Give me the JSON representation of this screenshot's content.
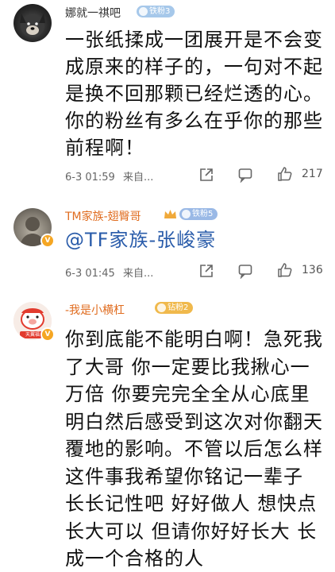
{
  "comments": [
    {
      "username": "娜就一祺吧",
      "fan_badge": "铁粉3",
      "text": "一张纸揉成一团展开是不会变成原来的样子的，一句对不起是换不回那颗已经烂透的心。你的粉丝有多么在乎你的那些前程啊！",
      "time": "6-3 01:59",
      "source": "来自...",
      "like_count": "217"
    },
    {
      "username": "TM家族-翅臀哥",
      "fan_badge": "铁粉5",
      "verified_badge": "V",
      "text": "@TF家族-张峻豪",
      "time": "6-3 01:45",
      "source": "来自...",
      "like_count": "136"
    },
    {
      "username": "-我是小横杠",
      "fan_badge": "钻粉2",
      "verified_badge": "V",
      "avatar_caption": "天翼福",
      "text": "你到底能不能明白啊！急死我了大哥 你一定要比我揪心一万倍 你要完完全全从心底里明白然后感受到这次对你翻天覆地的影响。不管以后怎么样这件事我希望你铭记一辈子 长长记性吧 好好做人 想快点长大可以 但请你好好长大 长成一个合格的人"
    }
  ],
  "colors": {
    "mention": "#2a5caa",
    "orange_name": "#e06c1f",
    "verified": "#f5a623"
  },
  "icons": [
    "share-icon",
    "comment-icon",
    "thumbs-up-icon"
  ]
}
